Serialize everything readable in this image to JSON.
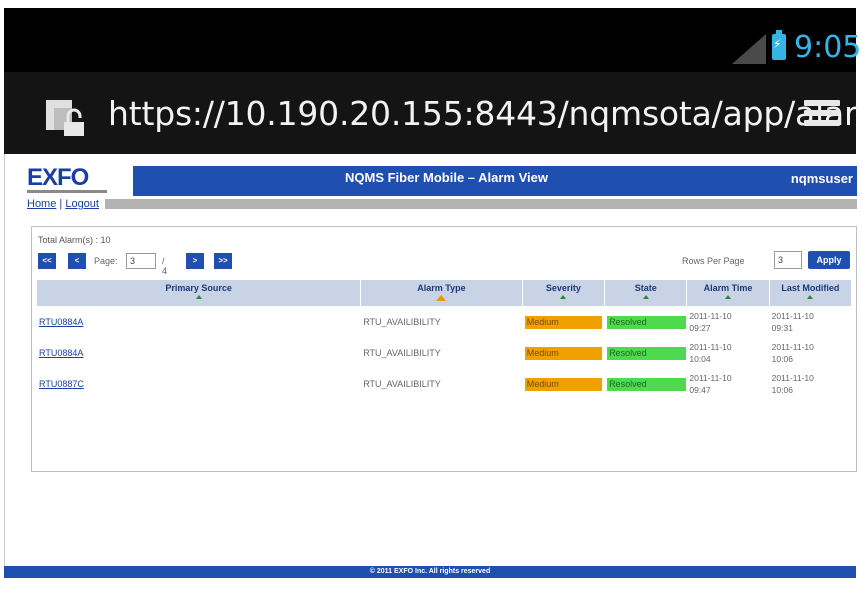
{
  "status_bar": {
    "time": "9:05",
    "icons": [
      "signal-icon",
      "battery-charging-icon"
    ]
  },
  "browser": {
    "url": "https://10.190.20.155:8443/nqmsota/app/alar",
    "icons": [
      "broken-lock-icon",
      "menu-icon"
    ]
  },
  "header": {
    "logo": "EXFO",
    "title": "NQMS Fiber Mobile – Alarm View",
    "user": "nqmsuser",
    "brand_color": "#1f4fb0"
  },
  "nav": {
    "home": "Home",
    "separator": "|",
    "logout": "Logout"
  },
  "summary": {
    "total_alarms": "Total Alarm(s) : 10"
  },
  "pager": {
    "first": "<<",
    "prev": "<",
    "page_label": "Page:",
    "page_value": "3",
    "page_total": "/ 4",
    "next": ">",
    "last": ">>"
  },
  "rows_per_page": {
    "label": "Rows Per Page",
    "value": "3",
    "apply": "Apply"
  },
  "table": {
    "columns": [
      "Primary Source",
      "Alarm Type",
      "Severity",
      "State",
      "Alarm Time",
      "Last Modified"
    ],
    "sorted_column": "Alarm Type",
    "rows": [
      {
        "source": "RTU0884A",
        "type": "RTU_AVAILIBILITY",
        "severity": "Medium",
        "state": "Resolved",
        "time_date": "2011-11-10",
        "time_clock": "09:27",
        "mod_date": "2011-11-10",
        "mod_clock": "09:31"
      },
      {
        "source": "RTU0884A",
        "type": "RTU_AVAILIBILITY",
        "severity": "Medium",
        "state": "Resolved",
        "time_date": "2011-11-10",
        "time_clock": "10:04",
        "mod_date": "2011-11-10",
        "mod_clock": "10:06"
      },
      {
        "source": "RTU0887C",
        "type": "RTU_AVAILIBILITY",
        "severity": "Medium",
        "state": "Resolved",
        "time_date": "2011-11-10",
        "time_clock": "09:47",
        "mod_date": "2011-11-10",
        "mod_clock": "10:06"
      }
    ],
    "severity_color": "#f0a000",
    "state_color": "#4ed94e"
  },
  "footer": {
    "text": "© 2011 EXFO Inc. All rights reserved"
  }
}
